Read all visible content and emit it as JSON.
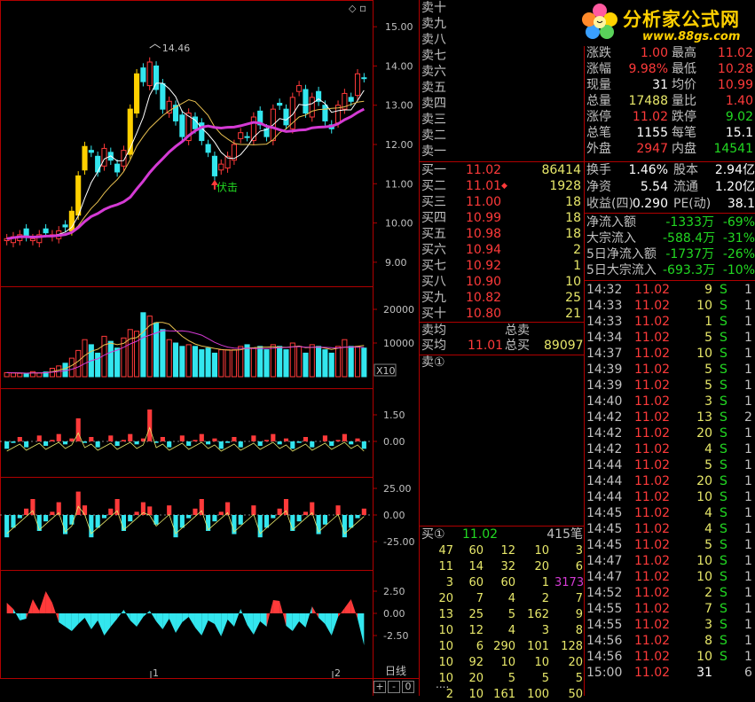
{
  "colors": {
    "up": "#ff3a3a",
    "down": "#33e6ee",
    "ma5": "#ffffff",
    "ma10": "#e8c050",
    "ma20": "#d43ad4",
    "grid": "#b00000",
    "green": "#22d822",
    "yellow": "#e8e86a"
  },
  "chart": {
    "price_axis": [
      "15.00",
      "14.00",
      "13.00",
      "12.00",
      "11.00",
      "10.00",
      "9.00"
    ],
    "high_label": "14.46",
    "signal_label": "伏击",
    "volume_axis": [
      "20000",
      "10000"
    ],
    "volume_unit": "X10",
    "ind1_axis": [
      "1.50",
      "0.00"
    ],
    "ind2_axis": [
      "25.00",
      "0.00",
      "-25.00"
    ],
    "ind3_axis": [
      "2.50",
      "0.00",
      "-2.50"
    ],
    "date_labels": [
      "1",
      "2"
    ],
    "period_label": "日线",
    "buttons": [
      "+",
      "-",
      "0"
    ],
    "corner_icon": "diamond-icon"
  },
  "chart_data": {
    "type": "candlestick",
    "close": [
      9.6,
      9.65,
      9.7,
      9.65,
      9.6,
      9.7,
      9.75,
      9.7,
      9.8,
      9.9,
      10.3,
      11.2,
      11.95,
      11.8,
      11.3,
      11.9,
      11.6,
      11.3,
      11.85,
      12.9,
      13.8,
      13.6,
      14.1,
      13.4,
      12.9,
      13.1,
      12.6,
      12.2,
      12.8,
      12.4,
      12.1,
      11.8,
      11.2,
      11.5,
      11.7,
      12.0,
      12.3,
      12.2,
      12.7,
      12.5,
      12.2,
      12.9,
      13.0,
      12.5,
      13.2,
      13.5,
      12.8,
      13.2,
      13.1,
      12.6,
      12.4,
      13.0,
      13.3,
      13.1,
      13.8,
      13.7
    ],
    "volume": [
      1200,
      1100,
      1000,
      900,
      1500,
      1100,
      1400,
      2500,
      3200,
      4000,
      5500,
      7800,
      11000,
      9500,
      7000,
      12000,
      10500,
      8500,
      11500,
      14000,
      13500,
      19000,
      18000,
      16000,
      14000,
      11000,
      10000,
      9000,
      9500,
      9000,
      8000,
      8500,
      7000,
      8000,
      8000,
      8000,
      9000,
      9500,
      8500,
      9000,
      8000,
      9500,
      9000,
      8000,
      10000,
      9000,
      7000,
      9500,
      9000,
      8000,
      7000,
      9000,
      11000,
      9000,
      9000,
      8500
    ],
    "ylim": [
      8.5,
      15.5
    ]
  },
  "sell": {
    "labels": [
      "卖十",
      "卖九",
      "卖八",
      "卖七",
      "卖六",
      "卖五",
      "卖四",
      "卖三",
      "卖二",
      "卖一"
    ]
  },
  "buy": {
    "labels": [
      "买一",
      "买二",
      "买三",
      "买四",
      "买五",
      "买六",
      "买七",
      "买八",
      "买九",
      "买十"
    ],
    "prices": [
      "11.02",
      "11.01",
      "11.00",
      "10.99",
      "10.98",
      "10.94",
      "10.92",
      "10.90",
      "10.82",
      "10.80"
    ],
    "volumes": [
      "86414",
      "1928",
      "18",
      "18",
      "18",
      "2",
      "1",
      "10",
      "25",
      "21"
    ]
  },
  "avg": {
    "sell_avg_label": "卖均",
    "buy_avg_label": "买均",
    "buy_avg_price": "11.01",
    "total_sell_label": "总卖",
    "total_buy_label": "总买",
    "total_buy_value": "89097",
    "sell_queue_label": "卖①"
  },
  "queue": {
    "label": "买①",
    "price": "11.02",
    "count": "415笔",
    "rows": [
      [
        "47",
        "60",
        "12",
        "10",
        "3"
      ],
      [
        "11",
        "14",
        "32",
        "20",
        "6"
      ],
      [
        "3",
        "60",
        "60",
        "1",
        "3173"
      ],
      [
        "20",
        "7",
        "4",
        "2",
        "7"
      ],
      [
        "13",
        "25",
        "5",
        "162",
        "9"
      ],
      [
        "10",
        "12",
        "4",
        "3",
        "8"
      ],
      [
        "10",
        "6",
        "290",
        "101",
        "128"
      ],
      [
        "10",
        "92",
        "10",
        "10",
        "20"
      ],
      [
        "10",
        "20",
        "5",
        "5",
        "5"
      ],
      [
        "2",
        "10",
        "161",
        "100",
        "50"
      ]
    ],
    "more": "...."
  },
  "logo": {
    "name": "分析家公式网",
    "url": "www.88gs.com"
  },
  "stats": {
    "rows": [
      {
        "l1": "涨跌",
        "v1": "1.00",
        "l2": "最高",
        "v2": "11.02",
        "c1": "red",
        "c2": "red"
      },
      {
        "l1": "涨幅",
        "v1": "9.98%",
        "l2": "最低",
        "v2": "10.28",
        "c1": "red",
        "c2": "red"
      },
      {
        "l1": "现量",
        "v1": "31",
        "l2": "均价",
        "v2": "10.99",
        "c1": "white",
        "c2": "red"
      },
      {
        "l1": "总量",
        "v1": "17488",
        "l2": "量比",
        "v2": "1.40",
        "c1": "yellow",
        "c2": "red"
      },
      {
        "l1": "涨停",
        "v1": "11.02",
        "l2": "跌停",
        "v2": "9.02",
        "c1": "red",
        "c2": "green"
      },
      {
        "l1": "总笔",
        "v1": "1155",
        "l2": "每笔",
        "v2": "15.1",
        "c1": "white",
        "c2": "white"
      },
      {
        "l1": "外盘",
        "v1": "2947",
        "l2": "内盘",
        "v2": "14541",
        "c1": "red",
        "c2": "green"
      }
    ],
    "rows2": [
      {
        "l1": "换手",
        "v1": "1.46%",
        "l2": "股本",
        "v2": "2.94亿"
      },
      {
        "l1": "净资",
        "v1": "5.54",
        "l2": "流通",
        "v2": "1.20亿"
      },
      {
        "l1": "收益(四)",
        "v1": "0.290",
        "l2": "PE(动)",
        "v2": "38.1"
      }
    ],
    "flows": [
      {
        "label": "净流入额",
        "value": "-1333万",
        "pct": "-69%"
      },
      {
        "label": "大宗流入",
        "value": "-588.4万",
        "pct": "-31%"
      },
      {
        "label": "5日净流入额",
        "value": "-1737万",
        "pct": "-26%"
      },
      {
        "label": "5日大宗流入",
        "value": "-693.3万",
        "pct": "-10%"
      }
    ]
  },
  "ticks": [
    {
      "t": "14:32",
      "p": "11.02",
      "v": "9",
      "s": "S",
      "n": "1",
      "vc": "yellow"
    },
    {
      "t": "14:33",
      "p": "11.02",
      "v": "10",
      "s": "S",
      "n": "1",
      "vc": "yellow"
    },
    {
      "t": "14:33",
      "p": "11.02",
      "v": "1",
      "s": "S",
      "n": "1",
      "vc": "yellow"
    },
    {
      "t": "14:34",
      "p": "11.02",
      "v": "5",
      "s": "S",
      "n": "1",
      "vc": "yellow"
    },
    {
      "t": "14:37",
      "p": "11.02",
      "v": "10",
      "s": "S",
      "n": "1",
      "vc": "yellow"
    },
    {
      "t": "14:39",
      "p": "11.02",
      "v": "5",
      "s": "S",
      "n": "1",
      "vc": "yellow"
    },
    {
      "t": "14:39",
      "p": "11.02",
      "v": "5",
      "s": "S",
      "n": "1",
      "vc": "yellow"
    },
    {
      "t": "14:40",
      "p": "11.02",
      "v": "3",
      "s": "S",
      "n": "1",
      "vc": "yellow"
    },
    {
      "t": "14:42",
      "p": "11.02",
      "v": "13",
      "s": "S",
      "n": "2",
      "vc": "yellow"
    },
    {
      "t": "14:42",
      "p": "11.02",
      "v": "20",
      "s": "S",
      "n": "1",
      "vc": "yellow"
    },
    {
      "t": "14:42",
      "p": "11.02",
      "v": "4",
      "s": "S",
      "n": "1",
      "vc": "yellow"
    },
    {
      "t": "14:44",
      "p": "11.02",
      "v": "5",
      "s": "S",
      "n": "1",
      "vc": "yellow"
    },
    {
      "t": "14:44",
      "p": "11.02",
      "v": "20",
      "s": "S",
      "n": "1",
      "vc": "yellow"
    },
    {
      "t": "14:44",
      "p": "11.02",
      "v": "10",
      "s": "S",
      "n": "1",
      "vc": "yellow"
    },
    {
      "t": "14:45",
      "p": "11.02",
      "v": "4",
      "s": "S",
      "n": "1",
      "vc": "yellow"
    },
    {
      "t": "14:45",
      "p": "11.02",
      "v": "4",
      "s": "S",
      "n": "1",
      "vc": "yellow"
    },
    {
      "t": "14:45",
      "p": "11.02",
      "v": "5",
      "s": "S",
      "n": "1",
      "vc": "yellow"
    },
    {
      "t": "14:47",
      "p": "11.02",
      "v": "10",
      "s": "S",
      "n": "1",
      "vc": "yellow"
    },
    {
      "t": "14:47",
      "p": "11.02",
      "v": "10",
      "s": "S",
      "n": "1",
      "vc": "yellow"
    },
    {
      "t": "14:52",
      "p": "11.02",
      "v": "2",
      "s": "S",
      "n": "1",
      "vc": "yellow"
    },
    {
      "t": "14:55",
      "p": "11.02",
      "v": "7",
      "s": "S",
      "n": "1",
      "vc": "yellow"
    },
    {
      "t": "14:55",
      "p": "11.02",
      "v": "3",
      "s": "S",
      "n": "1",
      "vc": "yellow"
    },
    {
      "t": "14:56",
      "p": "11.02",
      "v": "8",
      "s": "S",
      "n": "1",
      "vc": "yellow"
    },
    {
      "t": "14:56",
      "p": "11.02",
      "v": "10",
      "s": "S",
      "n": "1",
      "vc": "yellow"
    },
    {
      "t": "15:00",
      "p": "11.02",
      "v": "31",
      "s": "",
      "n": "6",
      "vc": "white"
    }
  ]
}
